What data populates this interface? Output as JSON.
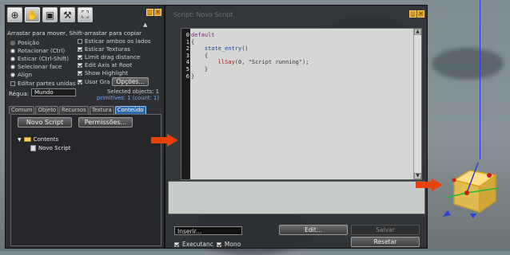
{
  "build": {
    "tools": [
      {
        "icon": "zoom-icon",
        "glyph": "⊕"
      },
      {
        "icon": "grab-icon",
        "glyph": "✋"
      },
      {
        "icon": "create-cube-icon",
        "glyph": "▣"
      },
      {
        "icon": "wand-icon",
        "glyph": "⚒"
      },
      {
        "icon": "land-icon",
        "glyph": "⛶"
      }
    ],
    "hint": "Arrastar para mover, Shift-arrastar para copiar",
    "edit_modes": [
      "Posição",
      "Rotacionar (Ctrl)",
      "Esticar (Ctrl-Shift)",
      "Selecionar face",
      "Align"
    ],
    "edit_linked": "Editar partes unidas",
    "options": [
      "Esticar ambos os lados",
      "Esticar Texturas",
      "Limit drag distance",
      "Edit Axis at Root",
      "Show Highlight",
      "Usar Gra"
    ],
    "opcoes_button": "Opções...",
    "regua_label": "Régua:",
    "regua_value": "Mundo",
    "selected_objects": "Selected objects: 1",
    "primitives": "primitives: 1 (count: 1)",
    "tabs": [
      "Comum",
      "Objeto",
      "Recursos",
      "Textura",
      "Conteúdo"
    ],
    "active_tab": "Conteúdo",
    "new_script_button": "Novo Script",
    "permissions_button": "Permissões...",
    "tree_folder": "Contents",
    "tree_item": "Novo Script"
  },
  "editor": {
    "title": "Script: Novo Script",
    "line_numbers": [
      "0",
      "1",
      "2",
      "3",
      "4",
      "5",
      "6"
    ],
    "code": {
      "l0": "default",
      "l1": "{",
      "l2_kw": "state_entry",
      "l2_rest": "()",
      "l3": "{",
      "l4_fn": "llSay",
      "l4_rest": "(0, \"Script running\");",
      "l5": "}",
      "l6": "}"
    },
    "insert_label": "Inserir...",
    "edit_button": "Edit...",
    "save_button": "Salvar",
    "reset_button": "Resetar",
    "running_label": "Executanc",
    "mono_label": "Mono"
  },
  "colors": {
    "arrow": "#e8410b",
    "tab_active": "#2a6bb0",
    "window_button": "#d7931e"
  }
}
